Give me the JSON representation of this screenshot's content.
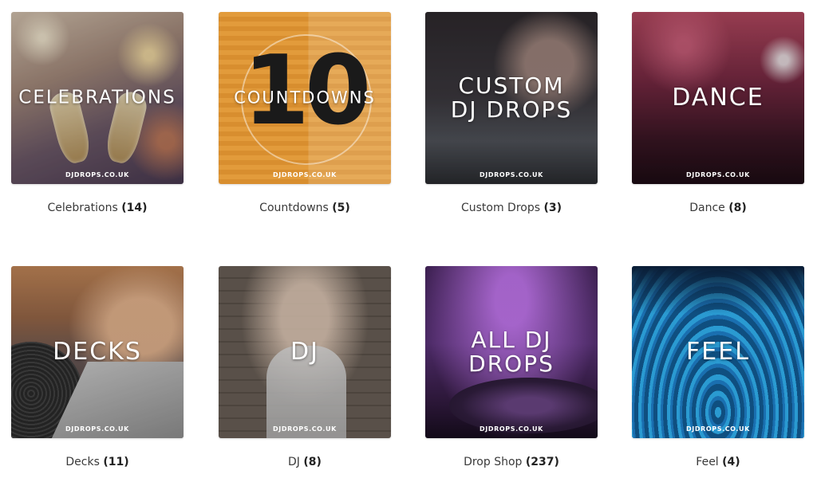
{
  "watermark": "DJDROPS.CO.UK",
  "categories": [
    {
      "image_title": "CELEBRATIONS",
      "label": "Celebrations",
      "count": "(14)"
    },
    {
      "image_title": "COUNTDOWNS",
      "label": "Countdowns",
      "count": "(5)",
      "big_number": "10"
    },
    {
      "image_title": "CUSTOM\nDJ DROPS",
      "label": "Custom Drops",
      "count": "(3)"
    },
    {
      "image_title": "DANCE",
      "label": "Dance",
      "count": "(8)"
    },
    {
      "image_title": "DECKS",
      "label": "Decks",
      "count": "(11)"
    },
    {
      "image_title": "DJ",
      "label": "DJ",
      "count": "(8)"
    },
    {
      "image_title": "ALL DJ\nDROPS",
      "label": "Drop Shop",
      "count": "(237)"
    },
    {
      "image_title": "FEEL",
      "label": "Feel",
      "count": "(4)"
    }
  ]
}
